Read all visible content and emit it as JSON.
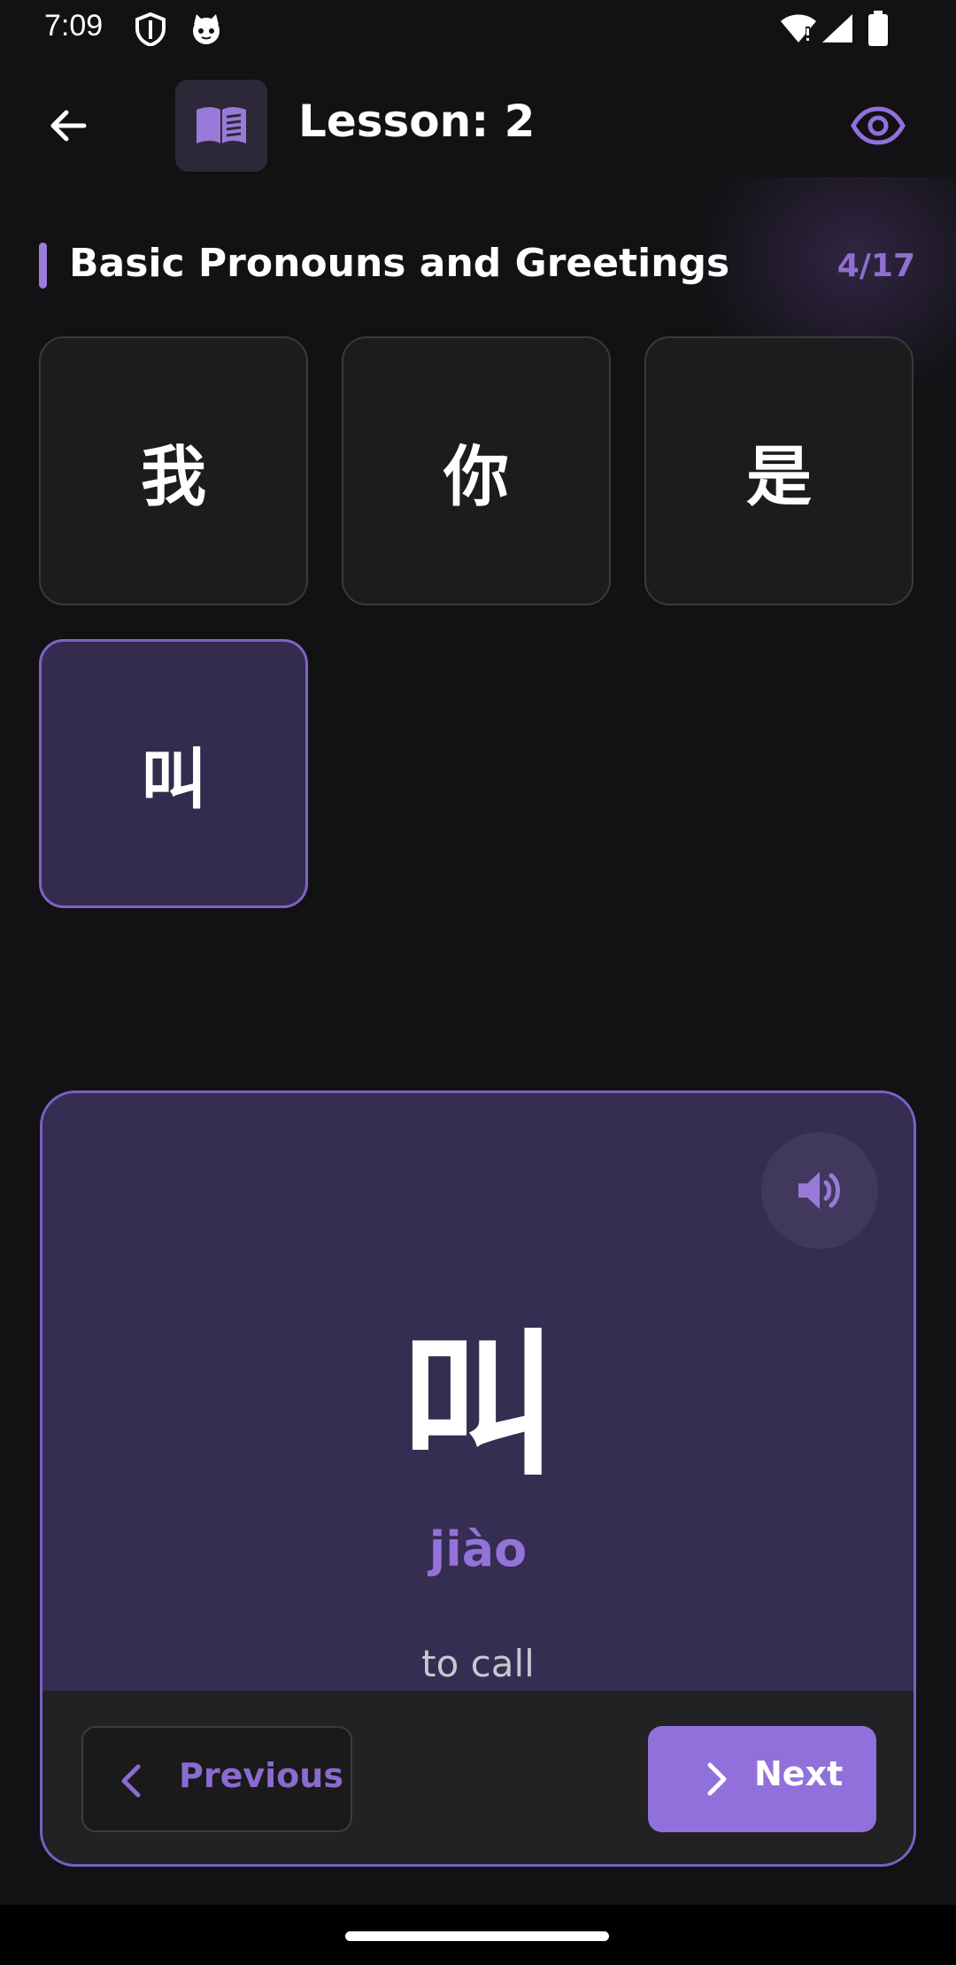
{
  "status_bar": {
    "time": "7:09",
    "left_icons": [
      "shield-icon",
      "cat-icon"
    ],
    "right_icons": [
      "wifi-icon",
      "signal-icon",
      "battery-icon"
    ]
  },
  "app_bar": {
    "back_icon": "arrow-back-icon",
    "lesson_icon": "open-book-icon",
    "title": "Lesson: 2",
    "visibility_icon": "eye-icon"
  },
  "section": {
    "title": "Basic Pronouns and Greetings",
    "progress": "4/17",
    "progress_current": 4,
    "progress_total": 17
  },
  "characters": [
    {
      "char": "我",
      "selected": false
    },
    {
      "char": "你",
      "selected": false
    },
    {
      "char": "是",
      "selected": false
    },
    {
      "char": "叫",
      "selected": true
    }
  ],
  "card": {
    "character": "叫",
    "pinyin": "jiào",
    "meaning": "to call",
    "speaker_icon": "speaker-icon",
    "previous_label": "Previous",
    "next_label": "Next"
  },
  "colors": {
    "accent": "#9270db",
    "background": "#121113",
    "card_background": "#352d52",
    "selected_tile": "#342c4e"
  }
}
